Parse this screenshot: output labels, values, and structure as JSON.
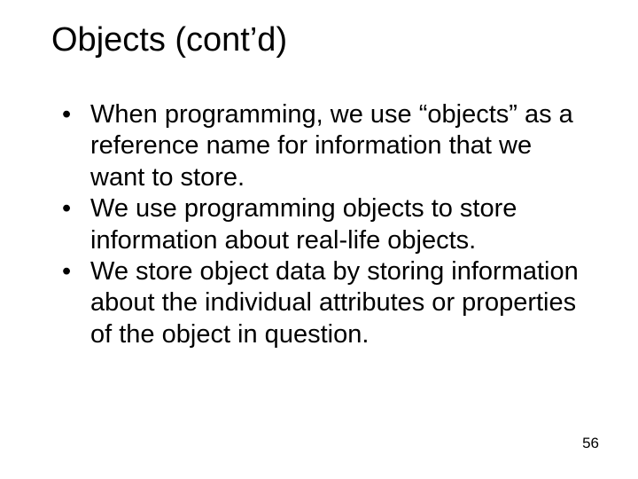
{
  "slide": {
    "title": "Objects (cont’d)",
    "bullets": [
      "When programming, we use “objects” as a reference name for information that we want to store.",
      "We use programming objects to store information about real-life objects.",
      "We store object data by storing information about the individual attributes or properties of the object in question."
    ],
    "page_number": "56"
  }
}
